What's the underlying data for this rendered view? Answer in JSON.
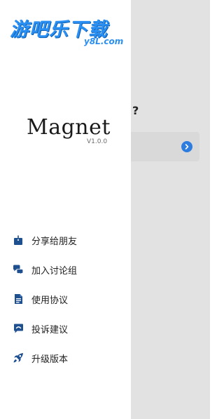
{
  "watermark": {
    "main": "游吧乐下载",
    "sub": "y8L.com"
  },
  "background_page": {
    "question_mark": "?"
  },
  "drawer": {
    "logo_text": "Magnet",
    "version": "V1.0.0",
    "menu": [
      {
        "label": "分享给朋友",
        "icon": "share-icon"
      },
      {
        "label": "加入讨论组",
        "icon": "chat-bubbles-icon"
      },
      {
        "label": "使用协议",
        "icon": "document-icon"
      },
      {
        "label": "投诉建议",
        "icon": "feedback-icon"
      },
      {
        "label": "升级版本",
        "icon": "rocket-icon"
      }
    ]
  },
  "colors": {
    "accent": "#1e4f8f",
    "link_blue": "#2d7de0",
    "scrim": "#e2e2e2",
    "watermark_blue": "#2a8ff2"
  }
}
